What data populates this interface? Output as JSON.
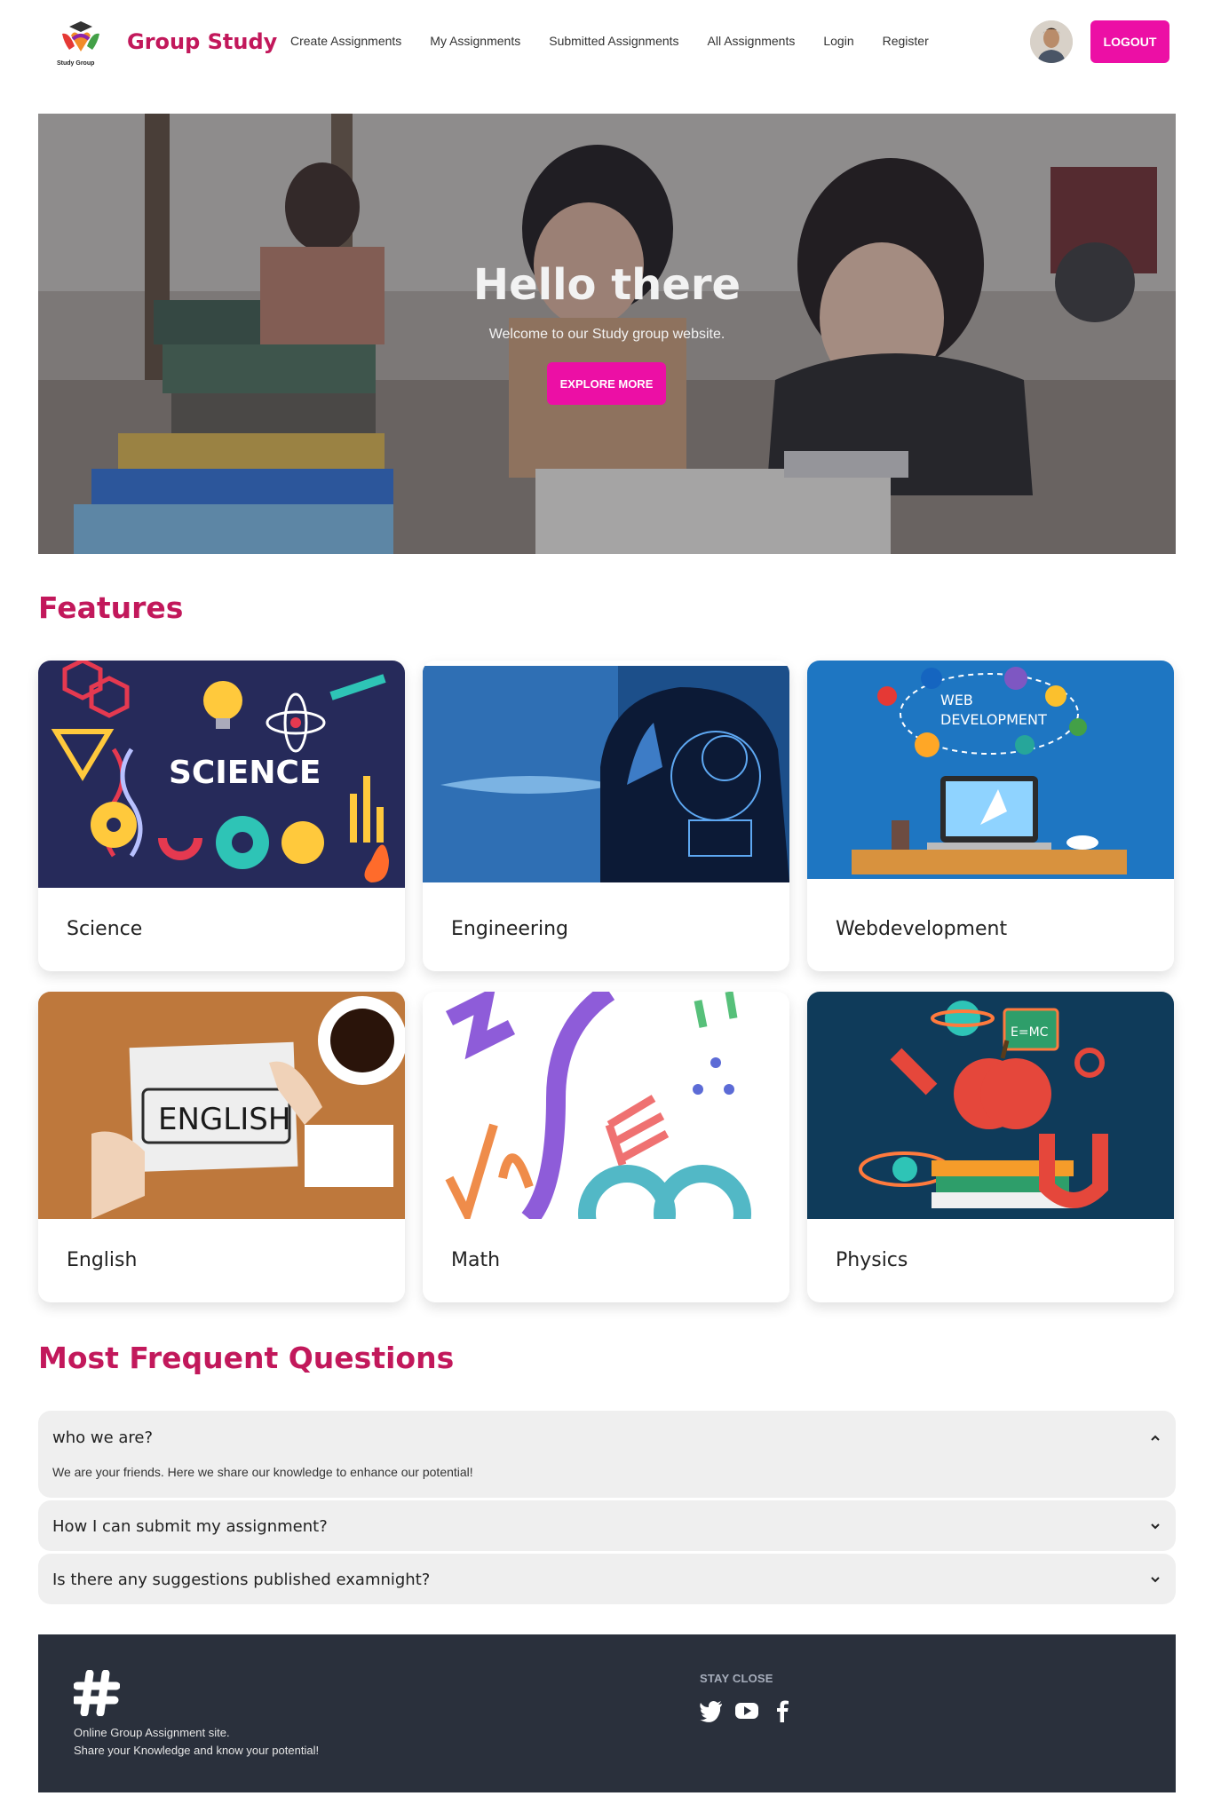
{
  "brand": {
    "name": "Group Study",
    "logo_text": "Study Group"
  },
  "nav": {
    "links": [
      "Create Assignments",
      "My Assignments",
      "Submitted Assignments",
      "All Assignments",
      "Login",
      "Register"
    ],
    "logout_label": "LOGOUT"
  },
  "hero": {
    "title": "Hello there",
    "subtitle": "Welcome to our Study group website.",
    "button_label": "EXPLORE MORE"
  },
  "features": {
    "title": "Features",
    "cards": [
      {
        "label": "Science",
        "image_text": "SCIENCE"
      },
      {
        "label": "Engineering"
      },
      {
        "label": "Webdevelopment",
        "image_text": "WEB DEVELOPMENT"
      },
      {
        "label": "English",
        "image_text": "ENGLISH"
      },
      {
        "label": "Math"
      },
      {
        "label": "Physics"
      }
    ]
  },
  "faq": {
    "title": "Most Frequent Questions",
    "items": [
      {
        "question": "who we are?",
        "answer": "We are your friends. Here we share our knowledge to enhance our potential!",
        "expanded": true
      },
      {
        "question": "How I can submit my assignment?",
        "expanded": false
      },
      {
        "question": "Is there any suggestions published examnight?",
        "expanded": false
      }
    ]
  },
  "footer": {
    "line1": "Online Group Assignment site.",
    "line2": "Share your Knowledge and know your potential!",
    "stay_close": "STAY CLOSE",
    "social_icons": [
      "twitter-icon",
      "youtube-icon",
      "facebook-icon"
    ]
  },
  "colors": {
    "accent": "#ec0fa5",
    "heading": "#c2185b",
    "footer_bg": "#2a303c"
  }
}
